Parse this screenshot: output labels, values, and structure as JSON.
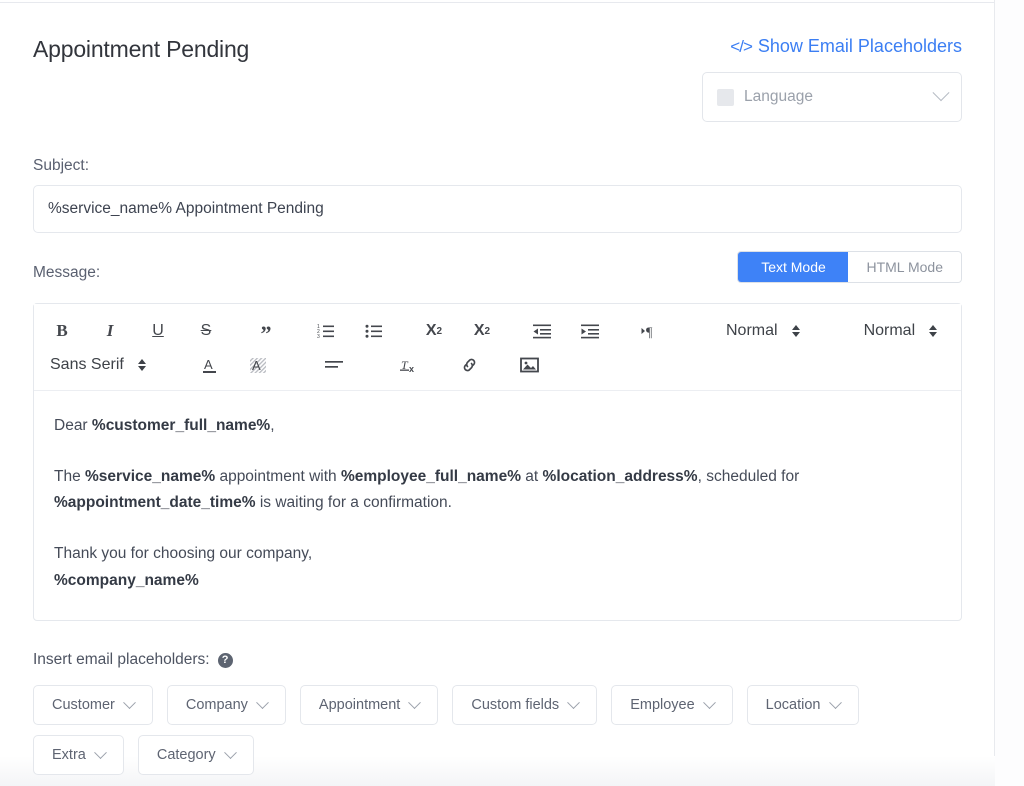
{
  "header": {
    "title": "Appointment Pending",
    "show_placeholders_label": "Show Email Placeholders",
    "code_glyph": "</>",
    "language_select": {
      "label": "Language",
      "icon": "chevron-down-icon"
    },
    "link_color": "#3b7ef3"
  },
  "subject": {
    "label": "Subject:",
    "value": "%service_name% Appointment Pending",
    "placeholder": ""
  },
  "message": {
    "label": "Message:",
    "modes": [
      {
        "label": "Text Mode",
        "active": true
      },
      {
        "label": "HTML Mode",
        "active": false
      }
    ],
    "active_mode_color": "#3e82f7",
    "toolbar": {
      "row1": [
        {
          "name": "bold-icon",
          "label": "B"
        },
        {
          "name": "italic-icon",
          "label": "I"
        },
        {
          "name": "underline-icon",
          "label": "U"
        },
        {
          "name": "strikethrough-icon",
          "label": "S"
        },
        {
          "name": "blockquote-icon",
          "label": "”"
        },
        {
          "name": "ordered-list-icon",
          "label": ""
        },
        {
          "name": "bullet-list-icon",
          "label": ""
        },
        {
          "name": "subscript-icon",
          "label": "X2"
        },
        {
          "name": "superscript-icon",
          "label": "X2"
        },
        {
          "name": "outdent-icon",
          "label": ""
        },
        {
          "name": "indent-icon",
          "label": ""
        },
        {
          "name": "text-direction-icon",
          "label": "¶"
        },
        {
          "name": "header-size-dropdown",
          "label": "Normal"
        },
        {
          "name": "font-size-dropdown",
          "label": "Normal"
        }
      ],
      "row2": [
        {
          "name": "font-family-dropdown",
          "label": "Sans Serif"
        },
        {
          "name": "text-color-icon",
          "label": "A"
        },
        {
          "name": "background-color-icon",
          "label": "A"
        },
        {
          "name": "align-icon",
          "label": ""
        },
        {
          "name": "clear-formatting-icon",
          "label": "Tx"
        },
        {
          "name": "link-icon",
          "label": ""
        },
        {
          "name": "image-icon",
          "label": ""
        }
      ],
      "header_dropdown_value": "Normal",
      "size_dropdown_value": "Normal",
      "font_dropdown_value": "Sans Serif"
    },
    "body": {
      "line1_prefix": "Dear ",
      "line1_placeholder": "%customer_full_name%",
      "line1_suffix": ",",
      "line2_a": "The ",
      "line2_ph1": "%service_name%",
      "line2_b": " appointment with ",
      "line2_ph2": "%employee_full_name%",
      "line2_c": " at ",
      "line2_ph3": "%location_address%",
      "line2_d": ", scheduled for ",
      "line2_ph4": "%appointment_date_time%",
      "line2_e": " is waiting for a confirmation.",
      "line3_a": "Thank you for choosing our company,",
      "line3_ph": "%company_name%"
    }
  },
  "placeholders": {
    "title": "Insert email placeholders:",
    "help_icon_label": "?",
    "buttons": [
      {
        "label": "Customer"
      },
      {
        "label": "Company"
      },
      {
        "label": "Appointment"
      },
      {
        "label": "Custom fields"
      },
      {
        "label": "Employee"
      },
      {
        "label": "Location"
      },
      {
        "label": "Extra"
      },
      {
        "label": "Category"
      }
    ]
  }
}
